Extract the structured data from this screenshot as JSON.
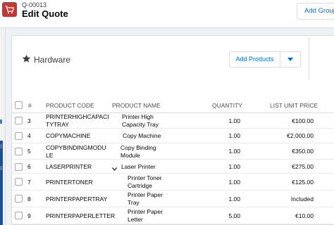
{
  "header": {
    "quote_number": "Q-00013",
    "title": "Edit Quote",
    "add_group_label": "Add Group"
  },
  "group": {
    "title": "Hardware",
    "add_products_label": "Add Products"
  },
  "table": {
    "columns": [
      "#",
      "PRODUCT CODE",
      "PRODUCT NAME",
      "QUANTITY",
      "LIST UNIT PRICE"
    ],
    "rows": [
      {
        "num": "3",
        "code": "PRINTERHIGHCAPACI TYTRAY",
        "name": "Printer High Capacity Tray",
        "quantity": "1.00",
        "price": "€100.00",
        "expandable": false
      },
      {
        "num": "4",
        "code": "COPYMACHINE",
        "name": "Copy Machine",
        "quantity": "1.00",
        "price": "€2,000.00",
        "expandable": false
      },
      {
        "num": "5",
        "code": "COPYBINDINGMODU LE",
        "name": "Copy Binding Module",
        "quantity": "1.00",
        "price": "€350.00",
        "expandable": false
      },
      {
        "num": "6",
        "code": "LASERPRINTER",
        "name": "Laser Printer",
        "quantity": "1.00",
        "price": "€275.00",
        "expandable": true
      },
      {
        "num": "7",
        "code": "PRINTERTONER",
        "name": "Printer Toner Cartridge",
        "quantity": "1.00",
        "price": "€125.00",
        "expandable": false
      },
      {
        "num": "8",
        "code": "PRINTERPAPERTRAY",
        "name": "Printer Paper Tray",
        "quantity": "1.00",
        "price": "Included",
        "expandable": false
      },
      {
        "num": "9",
        "code": "PRINTERPAPERLETTER",
        "name": "Printer Paper Letter",
        "quantity": "5.00",
        "price": "€10.00",
        "expandable": false
      }
    ]
  },
  "colors": {
    "accent": "#0070d2",
    "app_icon": "#c23934"
  },
  "icons": {
    "app": "cart-icon",
    "group": "star-icon",
    "dropdown": "chevron-down-icon",
    "expand": "chevron-down-icon"
  }
}
